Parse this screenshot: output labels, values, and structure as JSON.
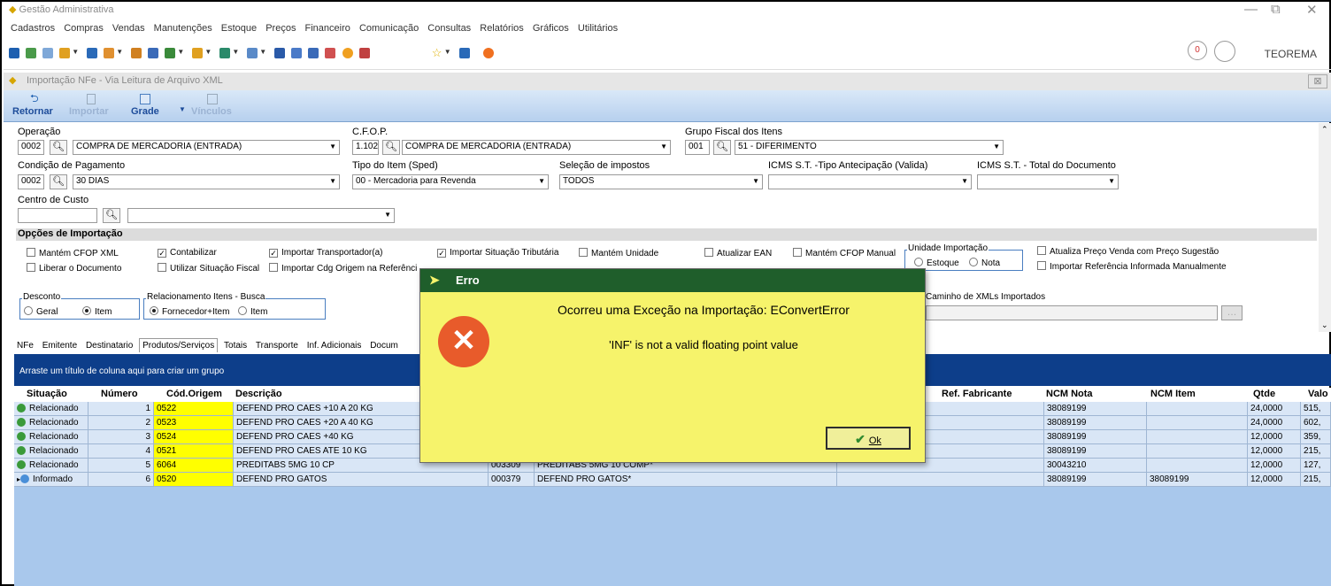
{
  "app": {
    "title": "Gestão Administrativa",
    "user": "TEOREMA",
    "win_min": "—",
    "win_max": "⧉",
    "win_close": "✕"
  },
  "menu": [
    "Cadastros",
    "Compras",
    "Vendas",
    "Manutenções",
    "Estoque",
    "Preços",
    "Financeiro",
    "Comunicação",
    "Consultas",
    "Relatórios",
    "Gráficos",
    "Utilitários"
  ],
  "subwindow": {
    "title": "Importação NFe - Via Leitura de Arquivo XML",
    "close": "⊠"
  },
  "ribbon": {
    "retornar": "Retornar",
    "importar": "Importar",
    "grade": "Grade",
    "vinculos": "Vínculos"
  },
  "form": {
    "operacao": {
      "label": "Operação",
      "code": "0002",
      "value": "COMPRA DE MERCADORIA (ENTRADA)"
    },
    "cfop": {
      "label": "C.F.O.P.",
      "code": "1.102",
      "value": "COMPRA DE MERCADORIA (ENTRADA)"
    },
    "grupo_fiscal": {
      "label": "Grupo Fiscal dos Itens",
      "code": "001",
      "value": "51 - DIFERIMENTO"
    },
    "cond_pagamento": {
      "label": "Condição de Pagamento",
      "code": "0002",
      "value": "30 DIAS"
    },
    "tipo_item": {
      "label": "Tipo do Item (Sped)",
      "value": "00 - Mercadoria para Revenda"
    },
    "selecao_impostos": {
      "label": "Seleção de impostos",
      "value": "TODOS"
    },
    "icms_st_tipo": {
      "label": "ICMS S.T. -Tipo Antecipação (Valida)",
      "value": ""
    },
    "icms_st_total": {
      "label": "ICMS S.T. - Total do Documento",
      "value": ""
    },
    "centro_custo": {
      "label": "Centro de Custo",
      "code": "",
      "value": ""
    }
  },
  "opcoes": {
    "title": "Opções de Importação",
    "mantem_cfop_xml": "Mantém CFOP XML",
    "liberar_documento": "Liberar o Documento",
    "contabilizar": "Contabilizar",
    "utilizar_situacao": "Utilizar Situação Fiscal",
    "importar_transportador": "Importar Transportador(a)",
    "importar_cdg_origem": "Importar Cdg Origem na Referênci",
    "importar_situacao_trib": "Importar Situação Tributária",
    "mantem_unidade": "Mantém Unidade",
    "atualizar_ean": "Atualizar EAN",
    "mantem_cfop_manual": "Mantém CFOP Manual",
    "unidade_importacao": "Unidade Importação",
    "estoque": "Estoque",
    "nota": "Nota",
    "atualiza_preco": "Atualiza Preço Venda com Preço Sugestão",
    "importar_referencia": "Importar Referência Informada Manualmente",
    "desconto": "Desconto",
    "geral": "Geral",
    "item": "Item",
    "relacionamento": "Relacionamento Itens - Busca",
    "fornecedor_item": "Fornecedor+Item",
    "item2": "Item",
    "caminho_xml": "Caminho de XMLs Importados"
  },
  "tabs": [
    "NFe",
    "Emitente",
    "Destinatario",
    "Produtos/Serviços",
    "Totais",
    "Transporte",
    "Inf. Adicionais",
    "Docum"
  ],
  "grid": {
    "group_hint": "Arraste um título de coluna aqui para criar um grupo",
    "columns": [
      "Situação",
      "Número",
      "Cód.Origem",
      "Descrição",
      "Ref. Fabricante",
      "NCM Nota",
      "NCM Item",
      "Qtde",
      "Valo"
    ],
    "rows": [
      {
        "situacao": "Relacionado",
        "numero": "1",
        "cod": "0522",
        "descricao": "DEFEND PRO CAES +10 A 20 KG",
        "cod2": "",
        "desc2": "",
        "ncm_nota": "38089199",
        "ncm_item": "",
        "qtde": "24,0000",
        "valor": "515,"
      },
      {
        "situacao": "Relacionado",
        "numero": "2",
        "cod": "0523",
        "descricao": "DEFEND PRO CAES +20 A 40 KG",
        "cod2": "",
        "desc2": "",
        "ncm_nota": "38089199",
        "ncm_item": "",
        "qtde": "24,0000",
        "valor": "602,"
      },
      {
        "situacao": "Relacionado",
        "numero": "3",
        "cod": "0524",
        "descricao": "DEFEND PRO CAES +40 KG",
        "cod2": "",
        "desc2": "",
        "ncm_nota": "38089199",
        "ncm_item": "",
        "qtde": "12,0000",
        "valor": "359,"
      },
      {
        "situacao": "Relacionado",
        "numero": "4",
        "cod": "0521",
        "descricao": "DEFEND PRO CAES ATE 10 KG",
        "cod2": "",
        "desc2": "",
        "ncm_nota": "38089199",
        "ncm_item": "",
        "qtde": "12,0000",
        "valor": "215,"
      },
      {
        "situacao": "Relacionado",
        "numero": "5",
        "cod": "6064",
        "descricao": "PREDITABS 5MG 10 CP",
        "cod2": "003309",
        "desc2": "PREDITABS 5MG 10 COMP*",
        "ncm_nota": "30043210",
        "ncm_item": "",
        "qtde": "12,0000",
        "valor": "127,"
      },
      {
        "situacao": "Informado",
        "numero": "6",
        "cod": "0520",
        "descricao": "DEFEND PRO GATOS",
        "cod2": "000379",
        "desc2": "DEFEND PRO GATOS*",
        "ncm_nota": "38089199",
        "ncm_item": "38089199",
        "qtde": "12,0000",
        "valor": "215,"
      }
    ]
  },
  "dialog": {
    "title": "Erro",
    "message1": "Ocorreu uma Exceção na Importação: EConvertError",
    "message2": "'INF' is not a valid floating point value",
    "ok": "Ok",
    "icon": "✕"
  },
  "colors": {
    "dialog_bg": "#f6f36b",
    "dialog_title": "#1f5e2b",
    "grid_header": "#0d3e8a",
    "grid_bg": "#a9c8ec",
    "highlight": "#ffff00",
    "status_green": "#3a9a3a",
    "status_blue": "#4a8fd8"
  }
}
